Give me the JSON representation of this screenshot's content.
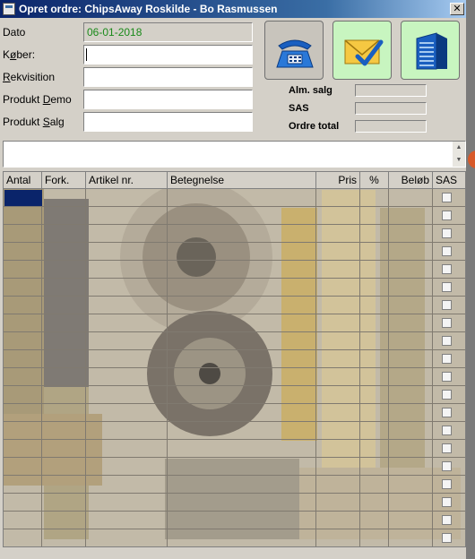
{
  "window": {
    "title": "Opret ordre: ChipsAway Roskilde - Bo Rasmussen",
    "close_label": "✕"
  },
  "form": {
    "dato_label": "Dato",
    "dato_value": "06-01-2018",
    "koeber_label_pre": "K",
    "koeber_label_ul": "ø",
    "koeber_label_post": "ber:",
    "koeber_value": "",
    "rekvisition_label_ul": "R",
    "rekvisition_label_post": "ekvisition",
    "rekvisition_value": "",
    "produkt_demo_label_pre": "Produkt ",
    "produkt_demo_label_ul": "D",
    "produkt_demo_label_post": "emo",
    "produkt_demo_value": "",
    "produkt_salg_label_pre": "Produkt ",
    "produkt_salg_label_ul": "S",
    "produkt_salg_label_post": "alg",
    "produkt_salg_value": ""
  },
  "buttons": {
    "phone_icon": "phone-icon",
    "mail_icon": "mail-check-icon",
    "building_icon": "building-icon",
    "phone_bg": "#c8c4bc",
    "mail_bg": "#c8f5c0",
    "building_bg": "#c8f5c0"
  },
  "summary": {
    "alm_salg_label": "Alm. salg",
    "sas_label": "SAS",
    "ordre_total_label": "Ordre total",
    "alm_salg_value": "",
    "sas_value": "",
    "ordre_total_value": ""
  },
  "grid": {
    "columns": [
      {
        "key": "antal",
        "label": "Antal",
        "align": "left"
      },
      {
        "key": "fork",
        "label": "Fork.",
        "align": "left"
      },
      {
        "key": "artikel",
        "label": "Artikel nr.",
        "align": "left"
      },
      {
        "key": "betegnelse",
        "label": "Betegnelse",
        "align": "left"
      },
      {
        "key": "pris",
        "label": "Pris",
        "align": "right"
      },
      {
        "key": "procent",
        "label": "%",
        "align": "center"
      },
      {
        "key": "beloeb",
        "label": "Beløb",
        "align": "right"
      },
      {
        "key": "sas",
        "label": "SAS",
        "align": "left"
      }
    ],
    "row_count": 20,
    "rows": []
  },
  "colors": {
    "titlebar_start": "#0a246a",
    "selection": "#0a246a",
    "date_text": "#1a8a1a"
  }
}
